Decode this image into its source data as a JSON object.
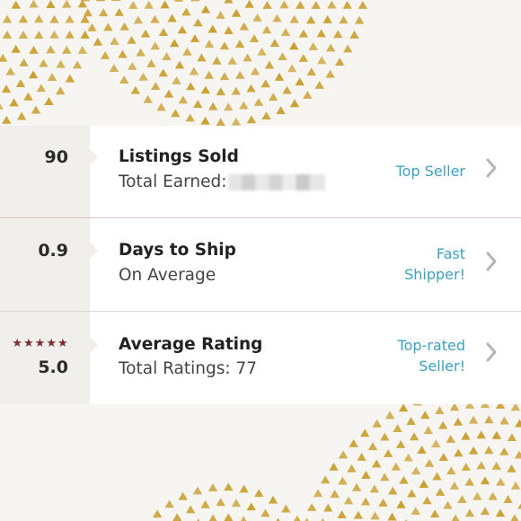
{
  "stats": [
    {
      "value": "90",
      "title": "Listings Sold",
      "subtitle": "Total Earned:",
      "badge_lines": [
        "Top Seller"
      ]
    },
    {
      "value": "0.9",
      "title": "Days to Ship",
      "subtitle": "On Average",
      "badge_lines": [
        "Fast",
        "Shipper!"
      ]
    },
    {
      "value": "5.0",
      "stars": "★★★★★",
      "title": "Average Rating",
      "subtitle": "Total Ratings: 77",
      "badge_lines": [
        "Top-rated",
        "Seller!"
      ]
    }
  ],
  "colors": {
    "badge": "#3ea0c0",
    "stars": "#7a2b30",
    "gold": "#c9a032",
    "background": "#f6f5f2",
    "chevron": "#b5b5b5"
  },
  "icons": {
    "row_arrow": "chevron-right-icon",
    "rating": "star-icon"
  }
}
